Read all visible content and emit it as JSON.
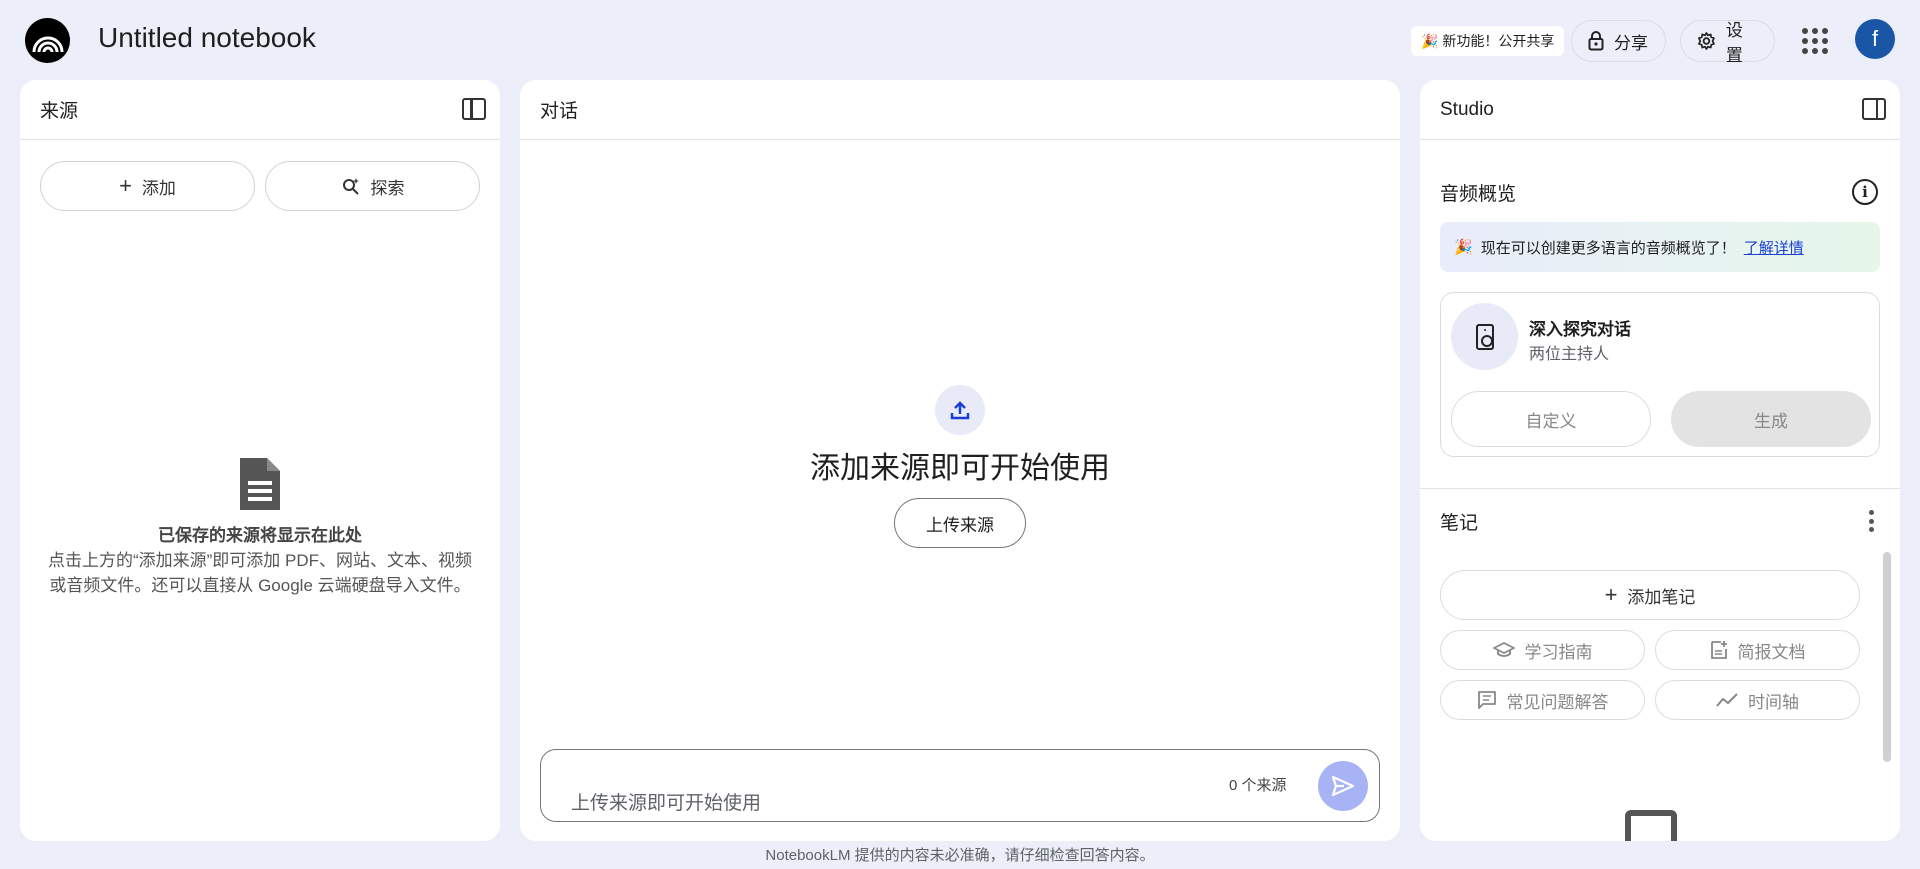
{
  "header": {
    "title": "Untitled notebook",
    "new_feature": "🎉 新功能！公开共享",
    "share_label": "分享",
    "settings_label": "设置",
    "avatar_letter": "f"
  },
  "sources": {
    "title": "来源",
    "add_label": "添加",
    "explore_label": "探索",
    "empty_title": "已保存的来源将显示在此处",
    "empty_desc": "点击上方的“添加来源”即可添加 PDF、网站、文本、视频或音频文件。还可以直接从 Google 云端硬盘导入文件。"
  },
  "chat": {
    "title": "对话",
    "headline": "添加来源即可开始使用",
    "upload_label": "上传来源",
    "input_placeholder": "上传来源即可开始使用",
    "source_count": "0 个来源"
  },
  "studio": {
    "title": "Studio",
    "audio_title": "音频概览",
    "notice_emoji": "🎉",
    "notice_text": "现在可以创建更多语言的音频概览了！",
    "notice_link": "了解详情",
    "card_title": "深入探究对话",
    "card_sub": "两位主持人",
    "customize_label": "自定义",
    "generate_label": "生成",
    "notes_title": "笔记",
    "add_note_label": "添加笔记",
    "chips": [
      "学习指南",
      "简报文档",
      "常见问题解答",
      "时间轴"
    ]
  },
  "footer": "NotebookLM 提供的内容未必准确，请仔细检查回答内容。"
}
